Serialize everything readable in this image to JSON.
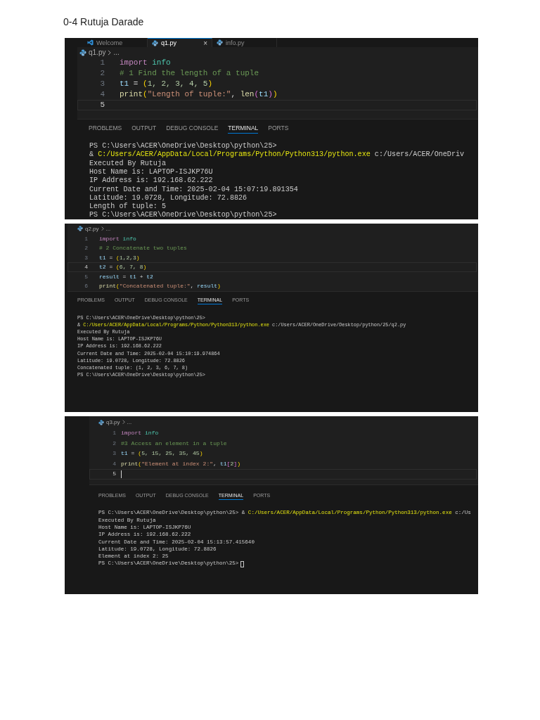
{
  "title": "0-4 Rutuja Darade",
  "screenshots": [
    {
      "editor_tabs": [
        {
          "label": "Welcome",
          "kind": "welcome",
          "selected": false
        },
        {
          "label": "q1.py",
          "kind": "python",
          "selected": true,
          "close": "×"
        },
        {
          "label": "info.py",
          "kind": "python",
          "selected": false
        }
      ],
      "breadcrumb": {
        "file": "q1.py",
        "rest": "..."
      },
      "code_lines": [
        {
          "number": "1",
          "current": false,
          "caret": false,
          "tokens": [
            {
              "text": "import",
              "kind": "keyword"
            },
            {
              "text": "info",
              "kind": "module"
            }
          ]
        },
        {
          "number": "2",
          "current": false,
          "caret": false,
          "tokens": [
            {
              "text": "# 1 Find the length of a tuple",
              "kind": "comment"
            }
          ]
        },
        {
          "number": "3",
          "current": false,
          "caret": false,
          "tokens": [
            {
              "text": "t1",
              "kind": "var"
            },
            {
              "text": " = ",
              "kind": "op"
            },
            {
              "text": "(",
              "kind": "paren"
            },
            {
              "text": "1, 2, 3, 4, 5",
              "kind": "number"
            },
            {
              "text": ")",
              "kind": "paren"
            }
          ]
        },
        {
          "number": "4",
          "current": false,
          "caret": false,
          "tokens": [
            {
              "text": "print",
              "kind": "func"
            },
            {
              "text": "(",
              "kind": "paren"
            },
            {
              "text": "\"Length of tuple:\"",
              "kind": "string"
            },
            {
              "text": ", ",
              "kind": "op"
            },
            {
              "text": "len",
              "kind": "func"
            },
            {
              "text": "(",
              "kind": "bracket"
            },
            {
              "text": "t1",
              "kind": "var"
            },
            {
              "text": ")",
              "kind": "bracket"
            },
            {
              "text": ")",
              "kind": "paren"
            }
          ]
        },
        {
          "number": "5",
          "current": true,
          "caret": false
        }
      ],
      "panel_tabs": [
        {
          "label": "PROBLEMS",
          "selected": false
        },
        {
          "label": "OUTPUT",
          "selected": false
        },
        {
          "label": "DEBUG CONSOLE",
          "selected": false
        },
        {
          "label": "TERMINAL",
          "selected": true
        },
        {
          "label": "PORTS",
          "selected": false
        }
      ],
      "terminal_lines": [
        {
          "cursor": false,
          "segments": [
            {
              "text": "PS C:\\Users\\ACER\\OneDrive\\Desktop\\python\\25>",
              "kind": "plain"
            }
          ]
        },
        {
          "cursor": false,
          "segments": [
            {
              "text": "& ",
              "kind": "plain"
            },
            {
              "text": "C:/Users/ACER/AppData/Local/Programs/Python/Python313/python.exe",
              "kind": "path"
            },
            {
              "text": " c:/Users/ACER/OneDriv",
              "kind": "plain"
            }
          ]
        },
        {
          "cursor": false,
          "segments": [
            {
              "text": "Executed By Rutuja",
              "kind": "plain"
            }
          ]
        },
        {
          "cursor": false,
          "segments": [
            {
              "text": "Host Name is: LAPTOP-ISJKP76U",
              "kind": "plain"
            }
          ]
        },
        {
          "cursor": false,
          "segments": [
            {
              "text": "IP Address is: 192.168.62.222",
              "kind": "plain"
            }
          ]
        },
        {
          "cursor": false,
          "segments": [
            {
              "text": "Current Date and Time: 2025-02-04 15:07:19.891354",
              "kind": "plain"
            }
          ]
        },
        {
          "cursor": false,
          "segments": [
            {
              "text": "Latitude: 19.0728, Longitude: 72.8826",
              "kind": "plain"
            }
          ]
        },
        {
          "cursor": false,
          "segments": [
            {
              "text": "Length of tuple: 5",
              "kind": "plain"
            }
          ]
        },
        {
          "cursor": false,
          "segments": [
            {
              "text": "PS C:\\Users\\ACER\\OneDrive\\Desktop\\python\\25>",
              "kind": "plain"
            }
          ]
        }
      ]
    },
    {
      "breadcrumb": {
        "file": "q2.py",
        "rest": "..."
      },
      "code_lines": [
        {
          "number": "1",
          "current": false,
          "caret": false,
          "tokens": [
            {
              "text": "import",
              "kind": "keyword"
            },
            {
              "text": "info",
              "kind": "module"
            }
          ]
        },
        {
          "number": "2",
          "current": false,
          "caret": false,
          "tokens": [
            {
              "text": "# 2 Concatenate two tuples",
              "kind": "comment"
            }
          ]
        },
        {
          "number": "3",
          "current": false,
          "caret": false,
          "tokens": [
            {
              "text": "t1",
              "kind": "var"
            },
            {
              "text": " = ",
              "kind": "op"
            },
            {
              "text": "(",
              "kind": "paren"
            },
            {
              "text": "1,2,3",
              "kind": "number"
            },
            {
              "text": ")",
              "kind": "paren"
            }
          ]
        },
        {
          "number": "4",
          "current": true,
          "caret": false,
          "tokens": [
            {
              "text": "t2",
              "kind": "var"
            },
            {
              "text": " = ",
              "kind": "op"
            },
            {
              "text": "(",
              "kind": "paren"
            },
            {
              "text": "6, 7, 8",
              "kind": "number"
            },
            {
              "text": ")",
              "kind": "paren"
            }
          ]
        },
        {
          "number": "5",
          "current": false,
          "caret": false,
          "tokens": [
            {
              "text": "result",
              "kind": "var"
            },
            {
              "text": " = ",
              "kind": "op"
            },
            {
              "text": "t1",
              "kind": "var"
            },
            {
              "text": " + ",
              "kind": "op"
            },
            {
              "text": "t2",
              "kind": "var"
            }
          ]
        },
        {
          "number": "6",
          "current": false,
          "caret": false,
          "tokens": [
            {
              "text": "print",
              "kind": "func"
            },
            {
              "text": "(",
              "kind": "paren"
            },
            {
              "text": "\"Concatenated tuple:\"",
              "kind": "string"
            },
            {
              "text": ", ",
              "kind": "op"
            },
            {
              "text": "result",
              "kind": "var"
            },
            {
              "text": ")",
              "kind": "paren"
            }
          ]
        }
      ],
      "panel_tabs": [
        {
          "label": "PROBLEMS",
          "selected": false
        },
        {
          "label": "OUTPUT",
          "selected": false
        },
        {
          "label": "DEBUG CONSOLE",
          "selected": false
        },
        {
          "label": "TERMINAL",
          "selected": true
        },
        {
          "label": "PORTS",
          "selected": false
        }
      ],
      "terminal_lines": [
        {
          "cursor": false,
          "segments": [
            {
              "text": "PS C:\\Users\\ACER\\OneDrive\\Desktop\\python\\25>",
              "kind": "plain"
            }
          ]
        },
        {
          "cursor": false,
          "segments": [
            {
              "text": "& ",
              "kind": "plain"
            },
            {
              "text": "C:/Users/ACER/AppData/Local/Programs/Python/Python313/python.exe",
              "kind": "path"
            },
            {
              "text": " c:/Users/ACER/OneDrive/Desktop/python/25/q2.py",
              "kind": "plain"
            }
          ]
        },
        {
          "cursor": false,
          "segments": [
            {
              "text": "Executed By Rutuja",
              "kind": "plain"
            }
          ]
        },
        {
          "cursor": false,
          "segments": [
            {
              "text": "Host Name is: LAPTOP-ISJKP76U",
              "kind": "plain"
            }
          ]
        },
        {
          "cursor": false,
          "segments": [
            {
              "text": "IP Address is: 192.168.62.222",
              "kind": "plain"
            }
          ]
        },
        {
          "cursor": false,
          "segments": [
            {
              "text": "Current Date and Time: 2025-02-04 15:10:19.974864",
              "kind": "plain"
            }
          ]
        },
        {
          "cursor": false,
          "segments": [
            {
              "text": "Latitude: 19.0728, Longitude: 72.8826",
              "kind": "plain"
            }
          ]
        },
        {
          "cursor": false,
          "segments": [
            {
              "text": "Concatenated tuple: (1, 2, 3, 6, 7, 8)",
              "kind": "plain"
            }
          ]
        },
        {
          "cursor": false,
          "segments": [
            {
              "text": "PS C:\\Users\\ACER\\OneDrive\\Desktop\\python\\25>",
              "kind": "plain"
            }
          ]
        }
      ]
    },
    {
      "breadcrumb": {
        "file": "q3.py",
        "rest": "..."
      },
      "code_lines": [
        {
          "number": "1",
          "current": false,
          "caret": false,
          "tokens": [
            {
              "text": "import",
              "kind": "keyword"
            },
            {
              "text": "info",
              "kind": "module"
            }
          ]
        },
        {
          "number": "2",
          "current": false,
          "caret": false,
          "tokens": [
            {
              "text": "#3 Access an element in a tuple",
              "kind": "comment"
            }
          ]
        },
        {
          "number": "3",
          "current": false,
          "caret": false,
          "tokens": [
            {
              "text": "t1",
              "kind": "var"
            },
            {
              "text": " = ",
              "kind": "op"
            },
            {
              "text": "(",
              "kind": "paren"
            },
            {
              "text": "5, 15, 25, 35, 45",
              "kind": "number"
            },
            {
              "text": ")",
              "kind": "paren"
            }
          ]
        },
        {
          "number": "4",
          "current": false,
          "caret": false,
          "tokens": [
            {
              "text": "print",
              "kind": "func"
            },
            {
              "text": "(",
              "kind": "paren"
            },
            {
              "text": "\"Element at index 2:\"",
              "kind": "string"
            },
            {
              "text": ", ",
              "kind": "op"
            },
            {
              "text": "t1",
              "kind": "var"
            },
            {
              "text": "[",
              "kind": "bracket"
            },
            {
              "text": "2",
              "kind": "number"
            },
            {
              "text": "]",
              "kind": "bracket"
            },
            {
              "text": ")",
              "kind": "paren"
            }
          ]
        },
        {
          "number": "5",
          "current": true,
          "caret": true
        }
      ],
      "panel_tabs": [
        {
          "label": "PROBLEMS",
          "selected": false
        },
        {
          "label": "OUTPUT",
          "selected": false
        },
        {
          "label": "DEBUG CONSOLE",
          "selected": false
        },
        {
          "label": "TERMINAL",
          "selected": true
        },
        {
          "label": "PORTS",
          "selected": false
        }
      ],
      "terminal_lines": [
        {
          "cursor": false,
          "segments": [
            {
              "text": "PS C:\\Users\\ACER\\OneDrive\\Desktop\\python\\25> & ",
              "kind": "plain"
            },
            {
              "text": "C:/Users/ACER/AppData/Local/Programs/Python/Python313/python.exe",
              "kind": "path"
            },
            {
              "text": " c:/Us",
              "kind": "plain"
            }
          ]
        },
        {
          "cursor": false,
          "segments": [
            {
              "text": "Executed By Rutuja",
              "kind": "plain"
            }
          ]
        },
        {
          "cursor": false,
          "segments": [
            {
              "text": "Host Name is: LAPTOP-ISJKP76U",
              "kind": "plain"
            }
          ]
        },
        {
          "cursor": false,
          "segments": [
            {
              "text": "IP Address is: 192.168.62.222",
              "kind": "plain"
            }
          ]
        },
        {
          "cursor": false,
          "segments": [
            {
              "text": "Current Date and Time: 2025-02-04 15:13:57.415640",
              "kind": "plain"
            }
          ]
        },
        {
          "cursor": false,
          "segments": [
            {
              "text": "Latitude: 19.0728, Longitude: 72.8826",
              "kind": "plain"
            }
          ]
        },
        {
          "cursor": false,
          "segments": [
            {
              "text": "Element at index 2: 25",
              "kind": "plain"
            }
          ]
        },
        {
          "cursor": true,
          "segments": [
            {
              "text": "PS C:\\Users\\ACER\\OneDrive\\Desktop\\python\\25>",
              "kind": "plain"
            }
          ]
        }
      ]
    }
  ]
}
